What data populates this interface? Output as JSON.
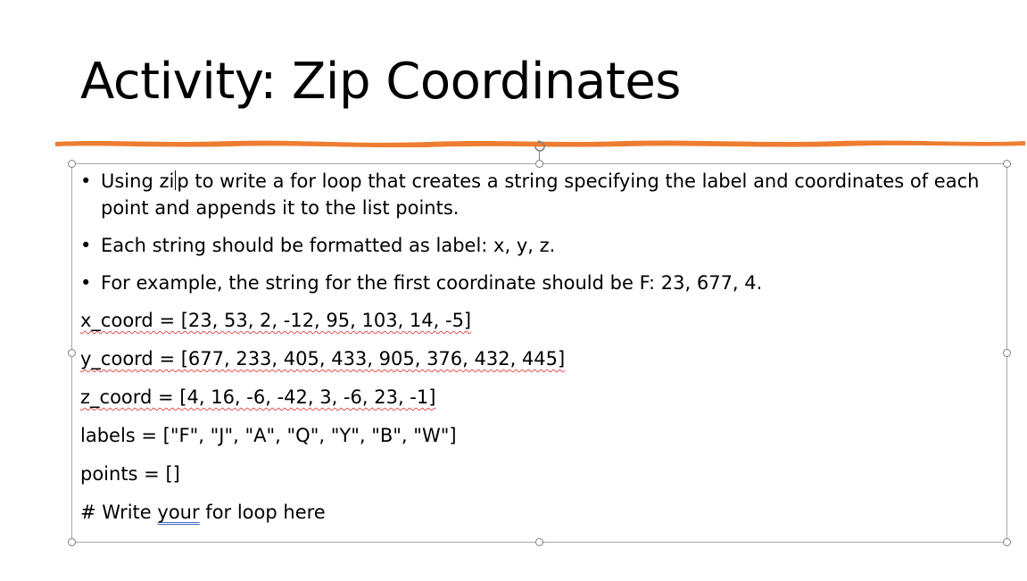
{
  "slide": {
    "title": "Activity: Zip Coordinates",
    "accent_color": "#ed7d31"
  },
  "bullets": [
    {
      "text_before_caret": "Using zi",
      "text_after_caret": "p to write a for loop that creates a string specifying the label and coordinates of each point and appends it to the list points."
    },
    {
      "text": "Each string should be formatted as label: x, y, z."
    },
    {
      "text": "For example, the string for the first coordinate should be F: 23, 677, 4."
    }
  ],
  "code": {
    "x_coord": "x_coord = [23, 53, 2, -12, 95, 103, 14, -5]",
    "y_coord": "y_coord = [677, 233, 405, 433, 905,  376,  432, 445]",
    "z_coord": "z_coord = [4, 16, -6, -42, 3, -6, 23, -1]",
    "labels": "labels = [\"F\", \"J\", \"A\", \"Q\", \"Y\", \"B\", \"W\"]",
    "points": "points = []",
    "comment_prefix": "# Write ",
    "comment_underlined": "your",
    "comment_suffix": " for loop here"
  }
}
